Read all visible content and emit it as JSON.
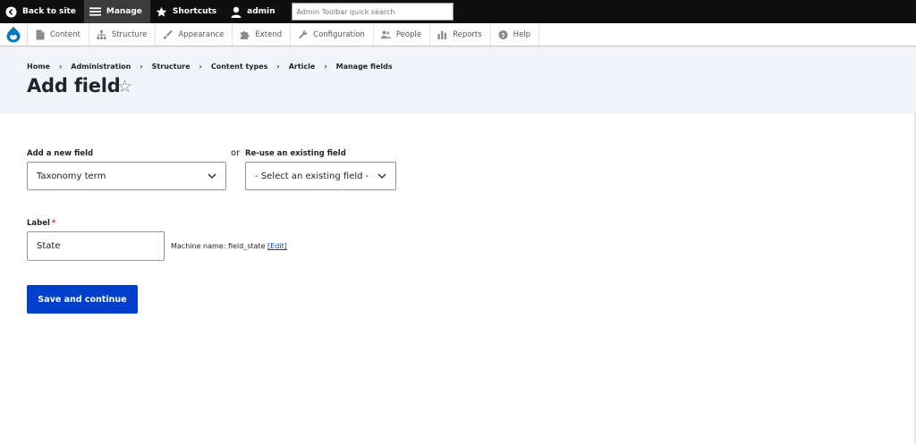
{
  "toolbar": {
    "back_label": "Back to site",
    "manage_label": "Manage",
    "shortcuts_label": "Shortcuts",
    "user_label": "admin",
    "search_placeholder": "Admin Toolbar quick search"
  },
  "tray": {
    "items": [
      {
        "label": "Content",
        "icon": "file-icon"
      },
      {
        "label": "Structure",
        "icon": "sitemap-icon"
      },
      {
        "label": "Appearance",
        "icon": "paintbrush-icon"
      },
      {
        "label": "Extend",
        "icon": "puzzle-icon"
      },
      {
        "label": "Configuration",
        "icon": "wrench-icon"
      },
      {
        "label": "People",
        "icon": "people-icon"
      },
      {
        "label": "Reports",
        "icon": "bar-chart-icon"
      },
      {
        "label": "Help",
        "icon": "help-icon"
      }
    ]
  },
  "breadcrumb": [
    "Home",
    "Administration",
    "Structure",
    "Content types",
    "Article",
    "Manage fields"
  ],
  "breadcrumb_separator": "›",
  "page": {
    "title": "Add field",
    "star": "☆"
  },
  "form": {
    "new_field_label": "Add a new field",
    "new_field_value": "Taxonomy term",
    "or_text": "or",
    "existing_field_label": "Re-use an existing field",
    "existing_field_value": "- Select an existing field -",
    "label_label": "Label",
    "required_mark": "*",
    "label_value": "State",
    "machine_name_prefix": "Machine name: field_state",
    "machine_name_edit": "[Edit]",
    "submit_label": "Save and continue"
  },
  "colors": {
    "toolbar_bg": "#0f0f0f",
    "header_bg": "#f3f4f9",
    "primary_button": "#003ecc",
    "link": "#003ecc",
    "required": "#dc2323",
    "drupal_blue": "#0678be"
  }
}
